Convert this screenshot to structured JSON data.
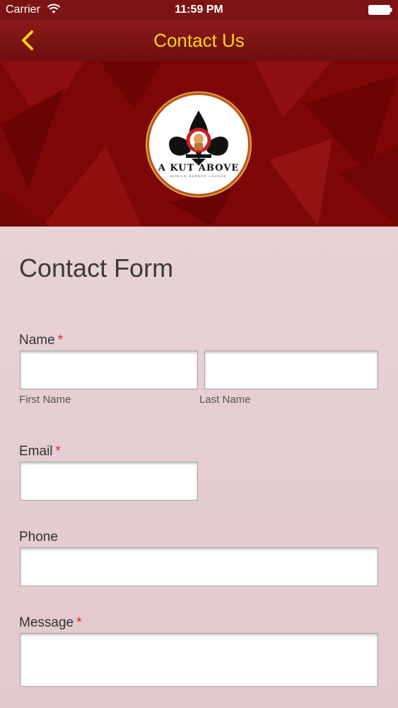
{
  "status_bar": {
    "carrier": "Carrier",
    "time": "11:59 PM"
  },
  "nav": {
    "title": "Contact Us",
    "back_icon": "chevron-left-icon"
  },
  "logo": {
    "text": "A KUT ABOVE",
    "subtext": "MOBILE BARBER LOUNGE"
  },
  "form": {
    "title": "Contact Form",
    "name_label": "Name",
    "first_name_sublabel": "First Name",
    "last_name_sublabel": "Last Name",
    "email_label": "Email",
    "phone_label": "Phone",
    "message_label": "Message",
    "required_mark": "*",
    "first_name_value": "",
    "last_name_value": "",
    "email_value": "",
    "phone_value": "",
    "message_value": ""
  },
  "colors": {
    "nav_bg": "#7c1414",
    "title_yellow": "#f7d51b",
    "required_red": "#e02020",
    "form_bg": "#e4ccd0"
  }
}
